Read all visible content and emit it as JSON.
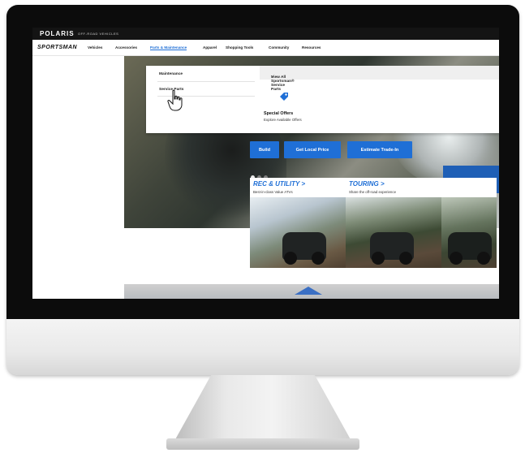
{
  "brand": {
    "logo": "POLARIS",
    "tagline": "OFF-ROAD VEHICLES"
  },
  "nav": {
    "logo": "SPORTSMAN",
    "items": [
      "Vehicles",
      "Accessories",
      "Parts & Maintenance",
      "Apparel",
      "Shopping Tools",
      "Community",
      "Resources"
    ],
    "active": "Parts & Maintenance"
  },
  "dropdown": {
    "items": [
      "Maintenance",
      "Service Parts"
    ],
    "view_all": "View All Sportsman® Service Parts",
    "view_all_arrow": ">",
    "offer_title": "Special Offers",
    "offer_subtitle": "Explore Available Offers",
    "offer_icon": "tag-icon"
  },
  "hero": {
    "buttons": [
      "Build",
      "Get Local Price",
      "Estimate Trade-In"
    ],
    "carousel_dots": 3,
    "active_dot": 1
  },
  "cards": [
    {
      "title": "REC & UTILITY",
      "arrow": ">",
      "subtitle": "Best-in-class Value ATVs"
    },
    {
      "title": "TOURING",
      "arrow": ">",
      "subtitle": "Share the off-road experience"
    }
  ],
  "colors": {
    "accent": "#1f6fd6",
    "bezel": "#0c0c0c",
    "topbar": "#141414"
  }
}
